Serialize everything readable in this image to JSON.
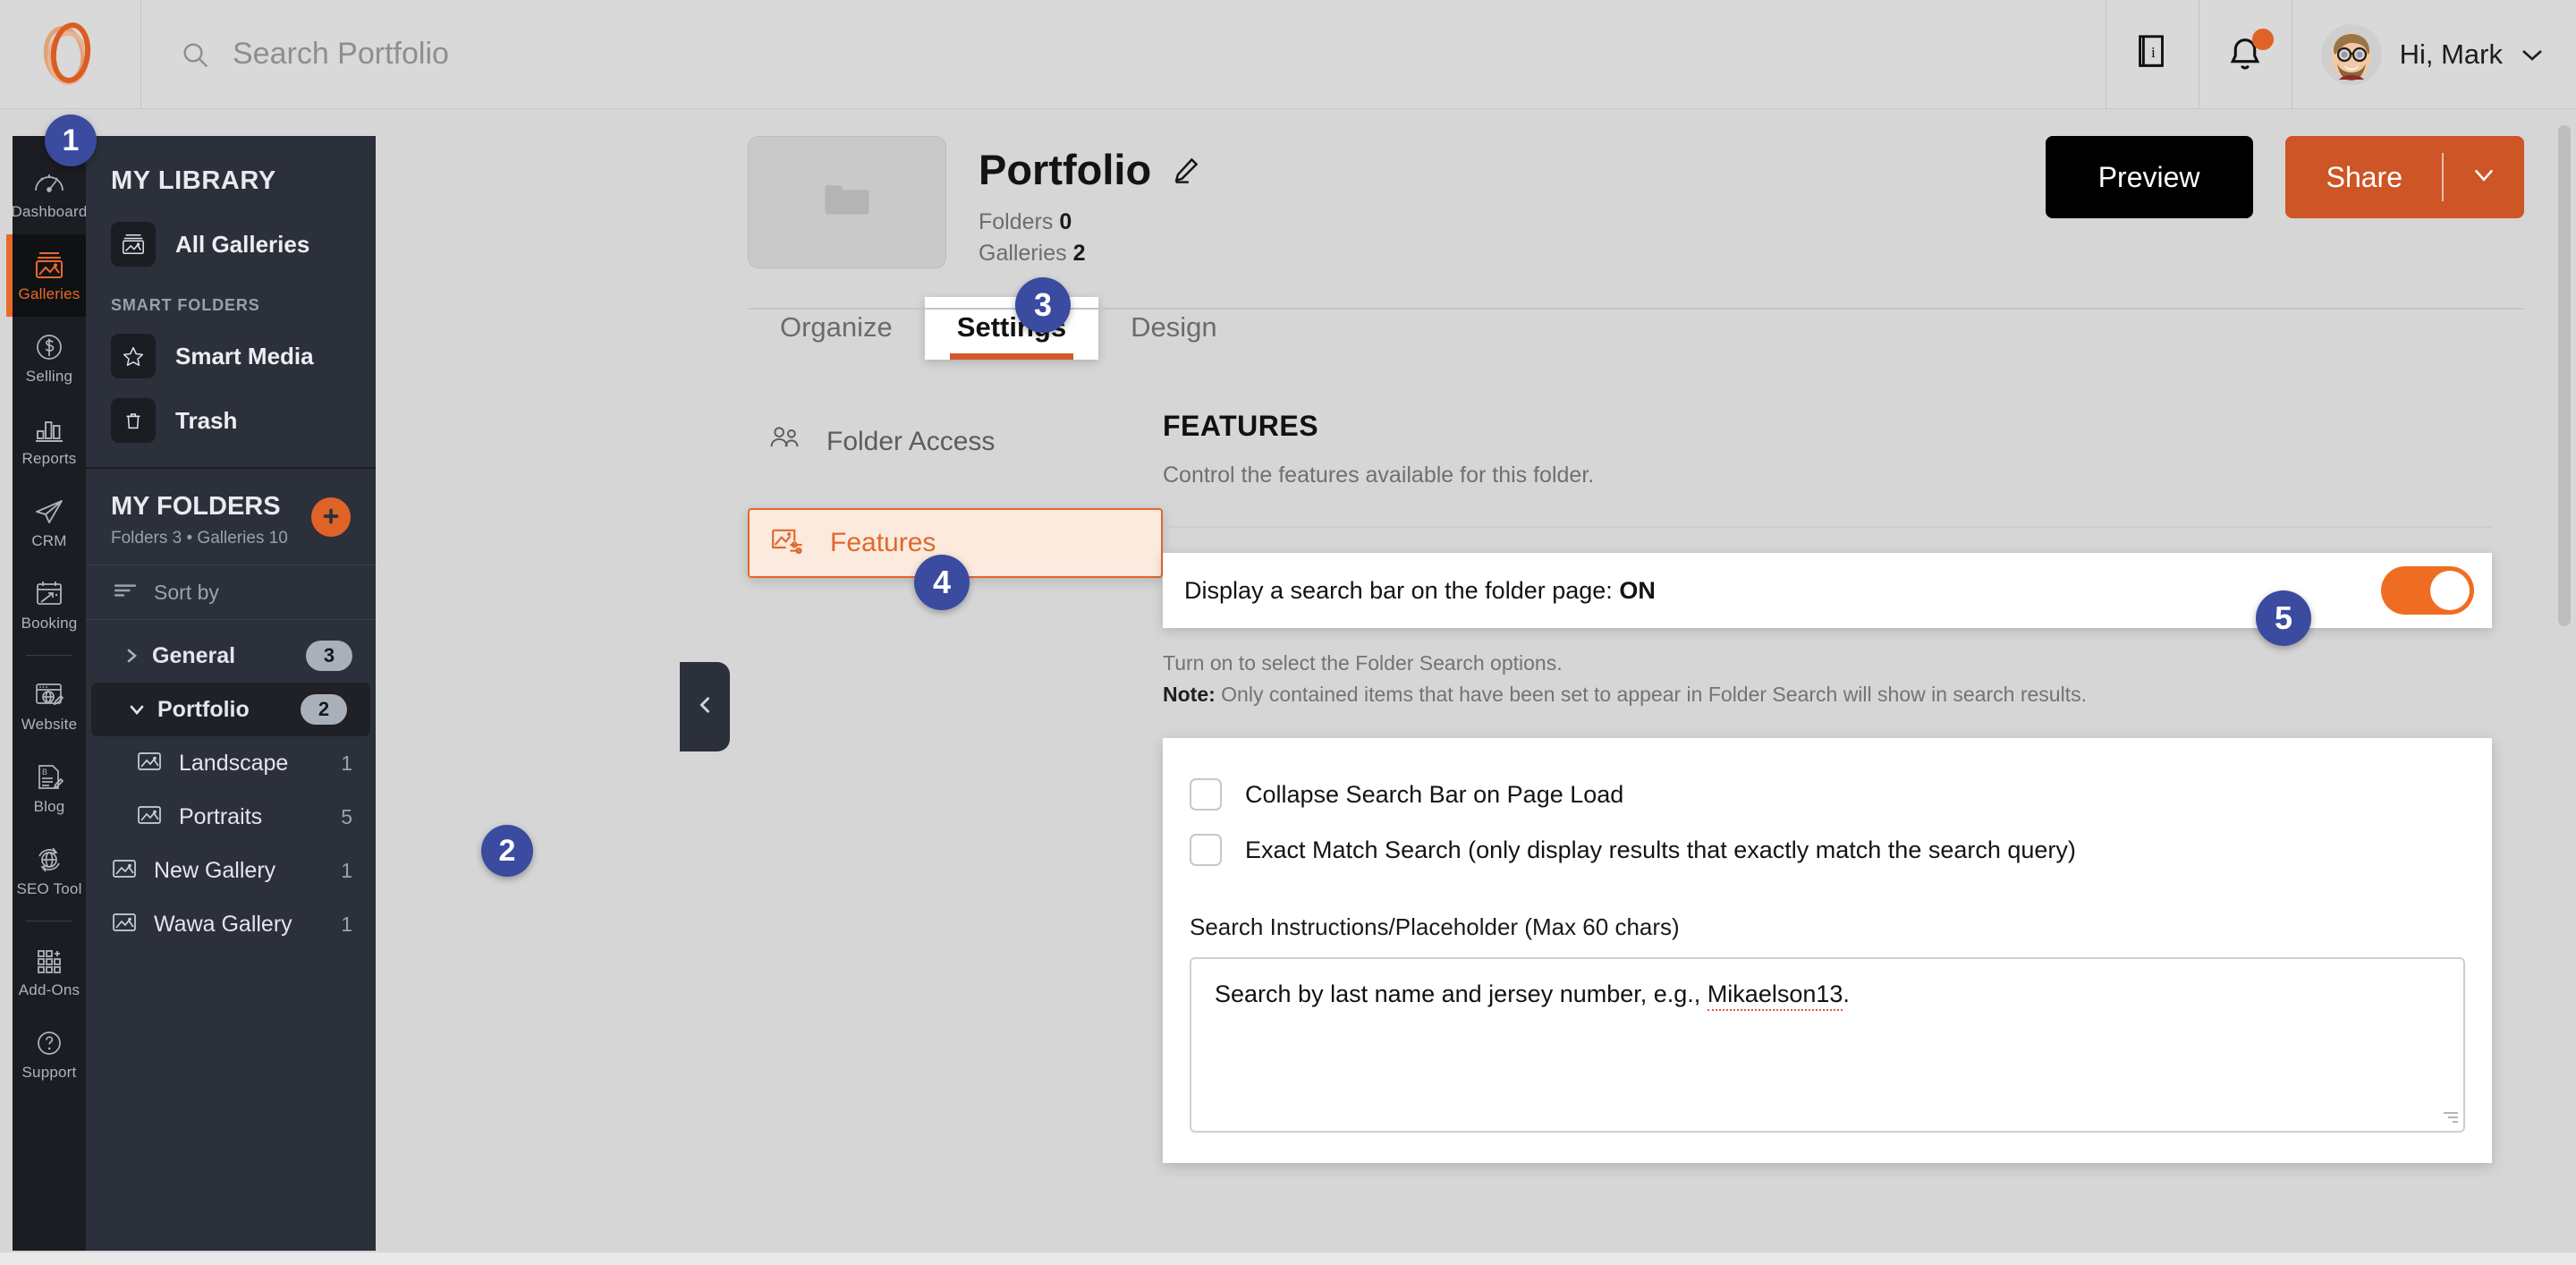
{
  "topbar": {
    "logo": "smugmug-logo-icon",
    "search": {
      "placeholder": "Search Portfolio",
      "value": "",
      "icon": "search-icon"
    },
    "guide_icon": "guide-book-icon",
    "notifications_icon": "bell-icon",
    "greeting": "Hi, Mark",
    "avatar": "user-avatar"
  },
  "rail": {
    "items": [
      {
        "label": "Dashboard",
        "icon": "speedometer-icon",
        "active": false
      },
      {
        "label": "Galleries",
        "icon": "gallery-image-icon",
        "active": true
      },
      {
        "label": "Selling",
        "icon": "dollar-circle-icon",
        "active": false
      },
      {
        "label": "Reports",
        "icon": "bar-chart-icon",
        "active": false
      },
      {
        "label": "CRM",
        "icon": "paper-plane-icon",
        "active": false
      },
      {
        "label": "Booking",
        "icon": "calendar-arrow-icon",
        "active": false
      },
      {
        "label": "Website",
        "icon": "browser-globe-pencil-icon",
        "active": false
      },
      {
        "label": "Blog",
        "icon": "blog-pencil-icon",
        "active": false
      },
      {
        "label": "SEO Tool",
        "icon": "seo-globe-refresh-icon",
        "active": false
      },
      {
        "label": "Add-Ons",
        "icon": "grid-plus-icon",
        "active": false
      },
      {
        "label": "Support",
        "icon": "question-circle-icon",
        "active": false
      }
    ]
  },
  "library": {
    "title": "MY LIBRARY",
    "all_galleries": {
      "label": "All Galleries",
      "icon": "gallery-image-icon"
    },
    "smart_folders_label": "SMART FOLDERS",
    "smart_items": [
      {
        "label": "Smart Media",
        "icon": "star-icon"
      },
      {
        "label": "Trash",
        "icon": "trash-icon"
      }
    ],
    "my_folders": {
      "title": "MY FOLDERS",
      "subtitle": "Folders 3 • Galleries 10",
      "add_icon": "plus-icon"
    },
    "sort_by": {
      "label": "Sort by",
      "icon": "sort-lines-icon"
    },
    "tree": [
      {
        "name": "General",
        "count": "3",
        "pill": true,
        "expanded": false,
        "selected": false,
        "depth": 0,
        "twisty": "chevron-right-icon",
        "icon": null
      },
      {
        "name": "Portfolio",
        "count": "2",
        "pill": true,
        "expanded": true,
        "selected": true,
        "depth": 0,
        "twisty": "chevron-down-icon",
        "icon": null
      },
      {
        "name": "Landscape",
        "count": "1",
        "pill": false,
        "expanded": null,
        "selected": false,
        "depth": 1,
        "twisty": null,
        "icon": "gallery-image-icon"
      },
      {
        "name": "Portraits",
        "count": "5",
        "pill": false,
        "expanded": null,
        "selected": false,
        "depth": 1,
        "twisty": null,
        "icon": "gallery-image-icon"
      },
      {
        "name": "New Gallery",
        "count": "1",
        "pill": false,
        "expanded": null,
        "selected": false,
        "depth": 0,
        "twisty": null,
        "icon": "gallery-image-icon"
      },
      {
        "name": "Wawa Gallery",
        "count": "1",
        "pill": false,
        "expanded": null,
        "selected": false,
        "depth": 0,
        "twisty": null,
        "icon": "gallery-image-icon"
      }
    ],
    "collapse_handle_icon": "chevron-left-icon"
  },
  "main": {
    "folder": {
      "thumb_icon": "folder-icon",
      "title": "Portfolio",
      "edit_icon": "pencil-icon",
      "folders_label": "Folders",
      "folders_count": "0",
      "galleries_label": "Galleries",
      "galleries_count": "2"
    },
    "actions": {
      "preview_label": "Preview",
      "share_label": "Share",
      "share_caret_icon": "chevron-down-icon"
    },
    "tabs": [
      {
        "label": "Organize",
        "active": false
      },
      {
        "label": "Settings",
        "active": true
      },
      {
        "label": "Design",
        "active": false
      }
    ],
    "settings_nav": [
      {
        "label": "Folder Access",
        "icon": "people-icon",
        "active": false
      },
      {
        "label": "Features",
        "icon": "image-sliders-icon",
        "active": true
      }
    ],
    "features": {
      "title": "FEATURES",
      "description": "Control the features available for this folder.",
      "search_toggle": {
        "label": "Display a search bar on the folder page:",
        "state": "ON",
        "enabled": true
      },
      "help_line_1": "Turn on to select the Folder Search options.",
      "help_note_label": "Note:",
      "help_note_text": " Only contained items that have been set to appear in Folder Search will show in search results.",
      "options": [
        {
          "label": "Collapse Search Bar on Page Load",
          "checked": false
        },
        {
          "label": "Exact Match Search (only display results that exactly match the search query)",
          "checked": false
        }
      ],
      "placeholder_field": {
        "label": "Search Instructions/Placeholder (Max 60 chars)",
        "value_before": "Search by last name and jersey number, e.g., ",
        "value_misspelled": "Mikaelson13",
        "value_after": "."
      }
    }
  },
  "callouts": [
    {
      "number": "1"
    },
    {
      "number": "2"
    },
    {
      "number": "3"
    },
    {
      "number": "4"
    },
    {
      "number": "5"
    }
  ],
  "colors": {
    "accent_orange": "#df6327",
    "share_orange": "#cd5526",
    "toggle_orange": "#ee6d22",
    "badge_blue": "#3a4ba0",
    "sidebar_dark": "#2b303b",
    "rail_dark": "#1b1d22"
  }
}
